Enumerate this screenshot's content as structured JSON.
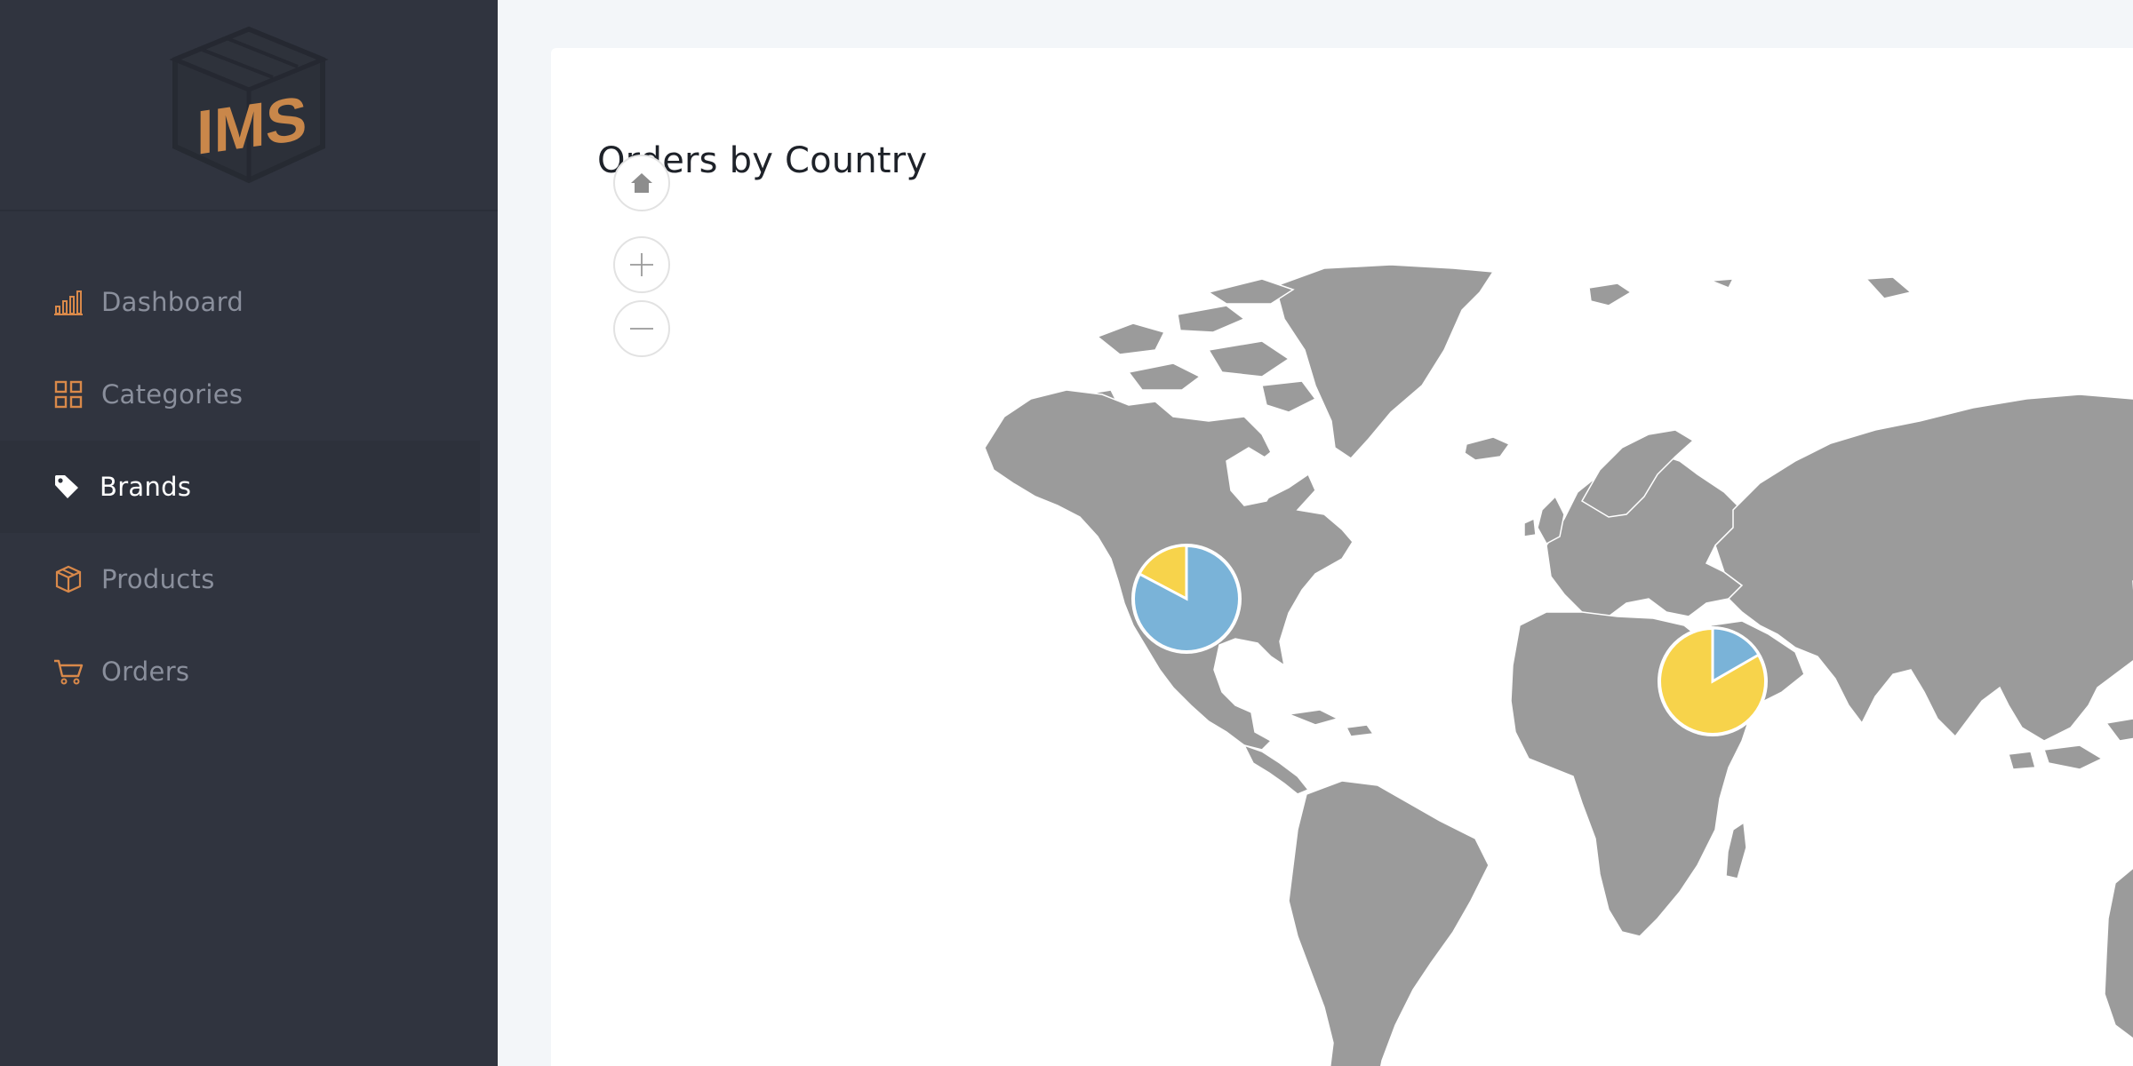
{
  "app": {
    "logo_text": "IMS"
  },
  "sidebar": {
    "items": [
      {
        "label": "Dashboard",
        "icon": "bar-chart-icon",
        "active": false
      },
      {
        "label": "Categories",
        "icon": "grid-icon",
        "active": false
      },
      {
        "label": "Brands",
        "icon": "tag-icon",
        "active": true
      },
      {
        "label": "Products",
        "icon": "box-icon",
        "active": false
      },
      {
        "label": "Orders",
        "icon": "cart-icon",
        "active": false
      }
    ]
  },
  "main": {
    "card_title": "Orders by Country",
    "map_controls": {
      "home": "home-icon",
      "zoom_in": "plus-icon",
      "zoom_out": "minus-icon"
    }
  },
  "colors": {
    "sidebar_bg": "#30343f",
    "accent": "#d9894a",
    "land": "#9b9b9b",
    "pie_blue": "#7ab3d8",
    "pie_yellow": "#f7d34b"
  }
}
